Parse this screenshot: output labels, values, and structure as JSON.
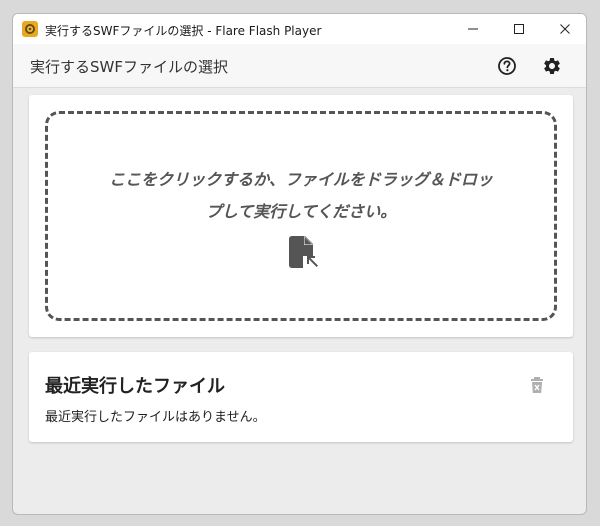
{
  "window": {
    "title": "実行するSWFファイルの選択 - Flare Flash Player",
    "icon": "flare-app-icon"
  },
  "titlebar_controls": {
    "minimize_icon": "minimize-icon",
    "maximize_icon": "maximize-icon",
    "close_icon": "close-icon"
  },
  "appbar": {
    "title": "実行するSWFファイルの選択",
    "help_icon": "help-circle-icon",
    "settings_icon": "gear-icon"
  },
  "drop_zone": {
    "line1": "ここをクリックするか、ファイルをドラッグ＆ドロッ",
    "line2": "プして実行してください。",
    "icon": "file-open-icon"
  },
  "recent": {
    "title": "最近実行したファイル",
    "empty_message": "最近実行したファイルはありません。",
    "clear_icon": "trash-icon"
  },
  "colors": {
    "text_dark": "#222222",
    "dashed_border": "#555555",
    "disabled_icon": "#b0b0b0"
  }
}
